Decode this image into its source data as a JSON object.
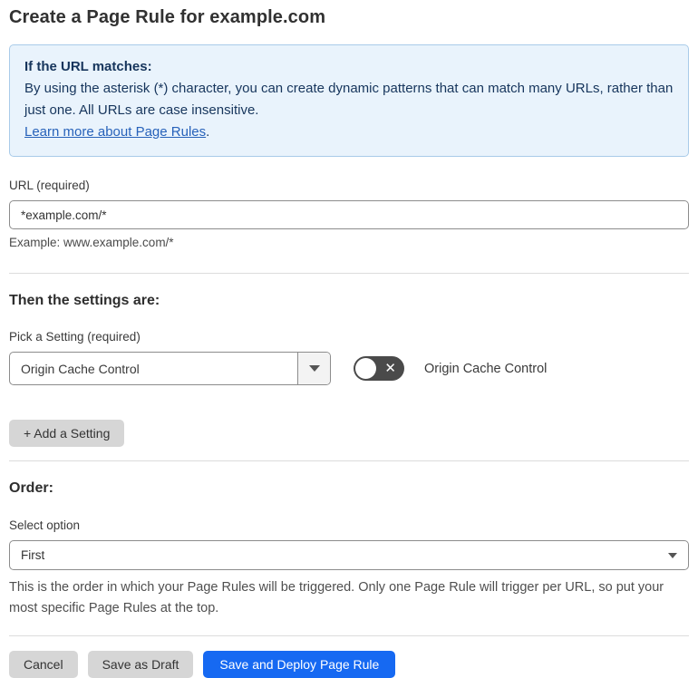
{
  "page": {
    "title": "Create a Page Rule for example.com"
  },
  "info_box": {
    "heading": "If the URL matches:",
    "body": "By using the asterisk (*) character, you can create dynamic patterns that can match many URLs, rather than just one. All URLs are case insensitive.",
    "link_label": "Learn more about Page Rules",
    "link_suffix": "."
  },
  "url_field": {
    "label": "URL (required)",
    "value": "*example.com/*",
    "helper": "Example: www.example.com/*"
  },
  "settings_section": {
    "heading": "Then the settings are:",
    "setting_label": "Pick a Setting (required)",
    "setting_value": "Origin Cache Control",
    "toggle_label": "Origin Cache Control",
    "toggle_state": "off",
    "toggle_x": "✕",
    "add_setting_label": "+ Add a Setting"
  },
  "order_section": {
    "heading": "Order:",
    "select_label": "Select option",
    "select_value": "First",
    "helper": "This is the order in which your Page Rules will be triggered. Only one Page Rule will trigger per URL, so put your most specific Page Rules at the top."
  },
  "actions": {
    "cancel_label": "Cancel",
    "save_draft_label": "Save as Draft",
    "save_deploy_label": "Save and Deploy Page Rule"
  },
  "colors": {
    "info_bg": "#e9f3fc",
    "info_border": "#a9cbe9",
    "info_text": "#16355c",
    "link": "#2762ba",
    "primary_button": "#1669f2",
    "gray_button": "#d6d6d6",
    "toggle_bg": "#4a4a4a"
  }
}
